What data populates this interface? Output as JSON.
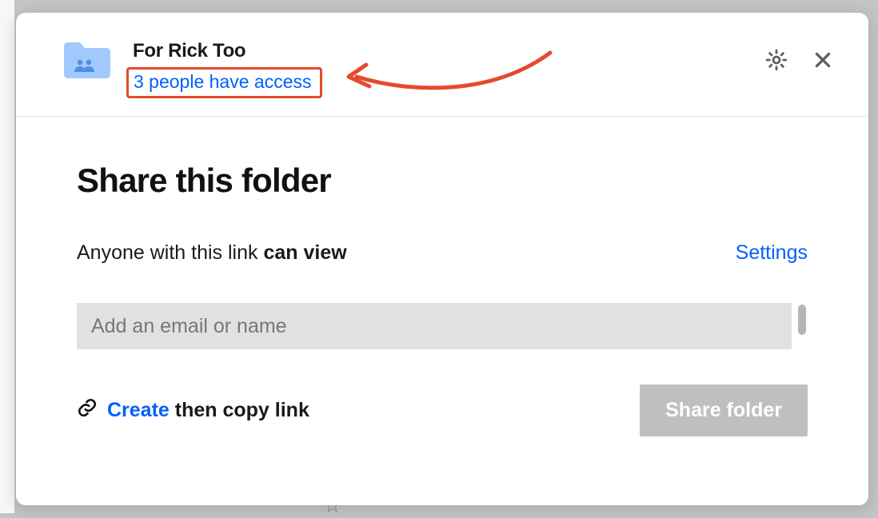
{
  "header": {
    "folder_name": "For Rick Too",
    "access_text": "3 people have access"
  },
  "body": {
    "heading": "Share this folder",
    "permission_prefix": "Anyone with this link ",
    "permission_bold": "can view",
    "settings_label": "Settings",
    "email_placeholder": "Add an email or name",
    "create_label": "Create",
    "create_rest": " then copy link",
    "share_button": "Share folder"
  },
  "icons": {
    "folder": "shared-folder-icon",
    "gear": "gear-icon",
    "close": "close-icon",
    "link": "link-icon"
  },
  "colors": {
    "accent": "#0061fe",
    "annotation": "#e34b2e",
    "folder_fill": "#a1c9fd"
  }
}
